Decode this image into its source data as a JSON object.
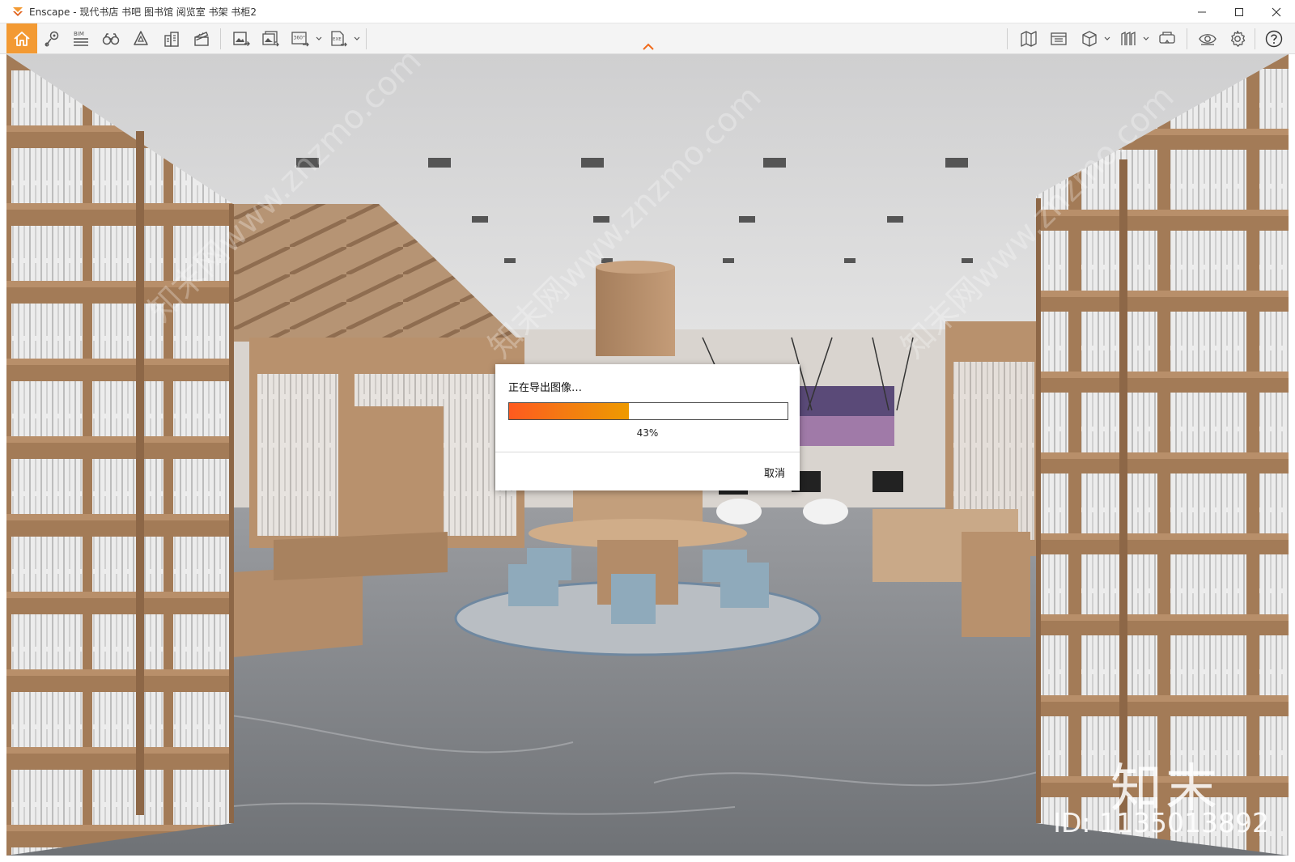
{
  "window": {
    "title": "Enscape - 现代书店 书吧 图书馆 阅览室 书架 书柜2",
    "controls": [
      "minimize",
      "maximize",
      "close"
    ]
  },
  "colors": {
    "accent": "#F39A33",
    "progress_start": "#FF5A1F",
    "progress_end": "#EE9A00",
    "toolbar_bg": "#F4F4F4"
  },
  "toolbar": {
    "left_buttons": [
      {
        "name": "home",
        "icon": "home-icon"
      },
      {
        "name": "views",
        "icon": "location-pin-icon"
      },
      {
        "name": "bim",
        "icon": "bim-icon",
        "label": "BIM"
      },
      {
        "name": "walk-mode",
        "icon": "binoculars-icon"
      },
      {
        "name": "assets",
        "icon": "atmosphere-icon"
      },
      {
        "name": "buildings",
        "icon": "buildings-icon"
      },
      {
        "name": "video",
        "icon": "clapperboard-icon"
      },
      {
        "name": "screenshot",
        "icon": "image-export-icon"
      },
      {
        "name": "batch-render",
        "icon": "batch-render-icon"
      },
      {
        "name": "panorama",
        "icon": "panorama-360-icon",
        "label": "360°"
      },
      {
        "name": "exe-export",
        "icon": "exe-export-icon",
        "label": "EXE"
      }
    ],
    "right_buttons": [
      {
        "name": "map",
        "icon": "map-icon"
      },
      {
        "name": "asset-library",
        "icon": "asset-library-icon"
      },
      {
        "name": "3d-view",
        "icon": "cube-icon"
      },
      {
        "name": "material",
        "icon": "material-icon"
      },
      {
        "name": "vr",
        "icon": "vr-headset-icon"
      },
      {
        "name": "visual-settings",
        "icon": "eye-icon"
      },
      {
        "name": "settings",
        "icon": "gear-icon"
      },
      {
        "name": "help",
        "icon": "help-icon"
      }
    ]
  },
  "dialog": {
    "title": "正在导出图像…",
    "progress": 0.43,
    "progress_text": "43%",
    "cancel_label": "取消"
  },
  "watermark": {
    "diagonal": "知末网www.znzmo.com",
    "brand": "知末",
    "id": "ID: 1135013892"
  }
}
